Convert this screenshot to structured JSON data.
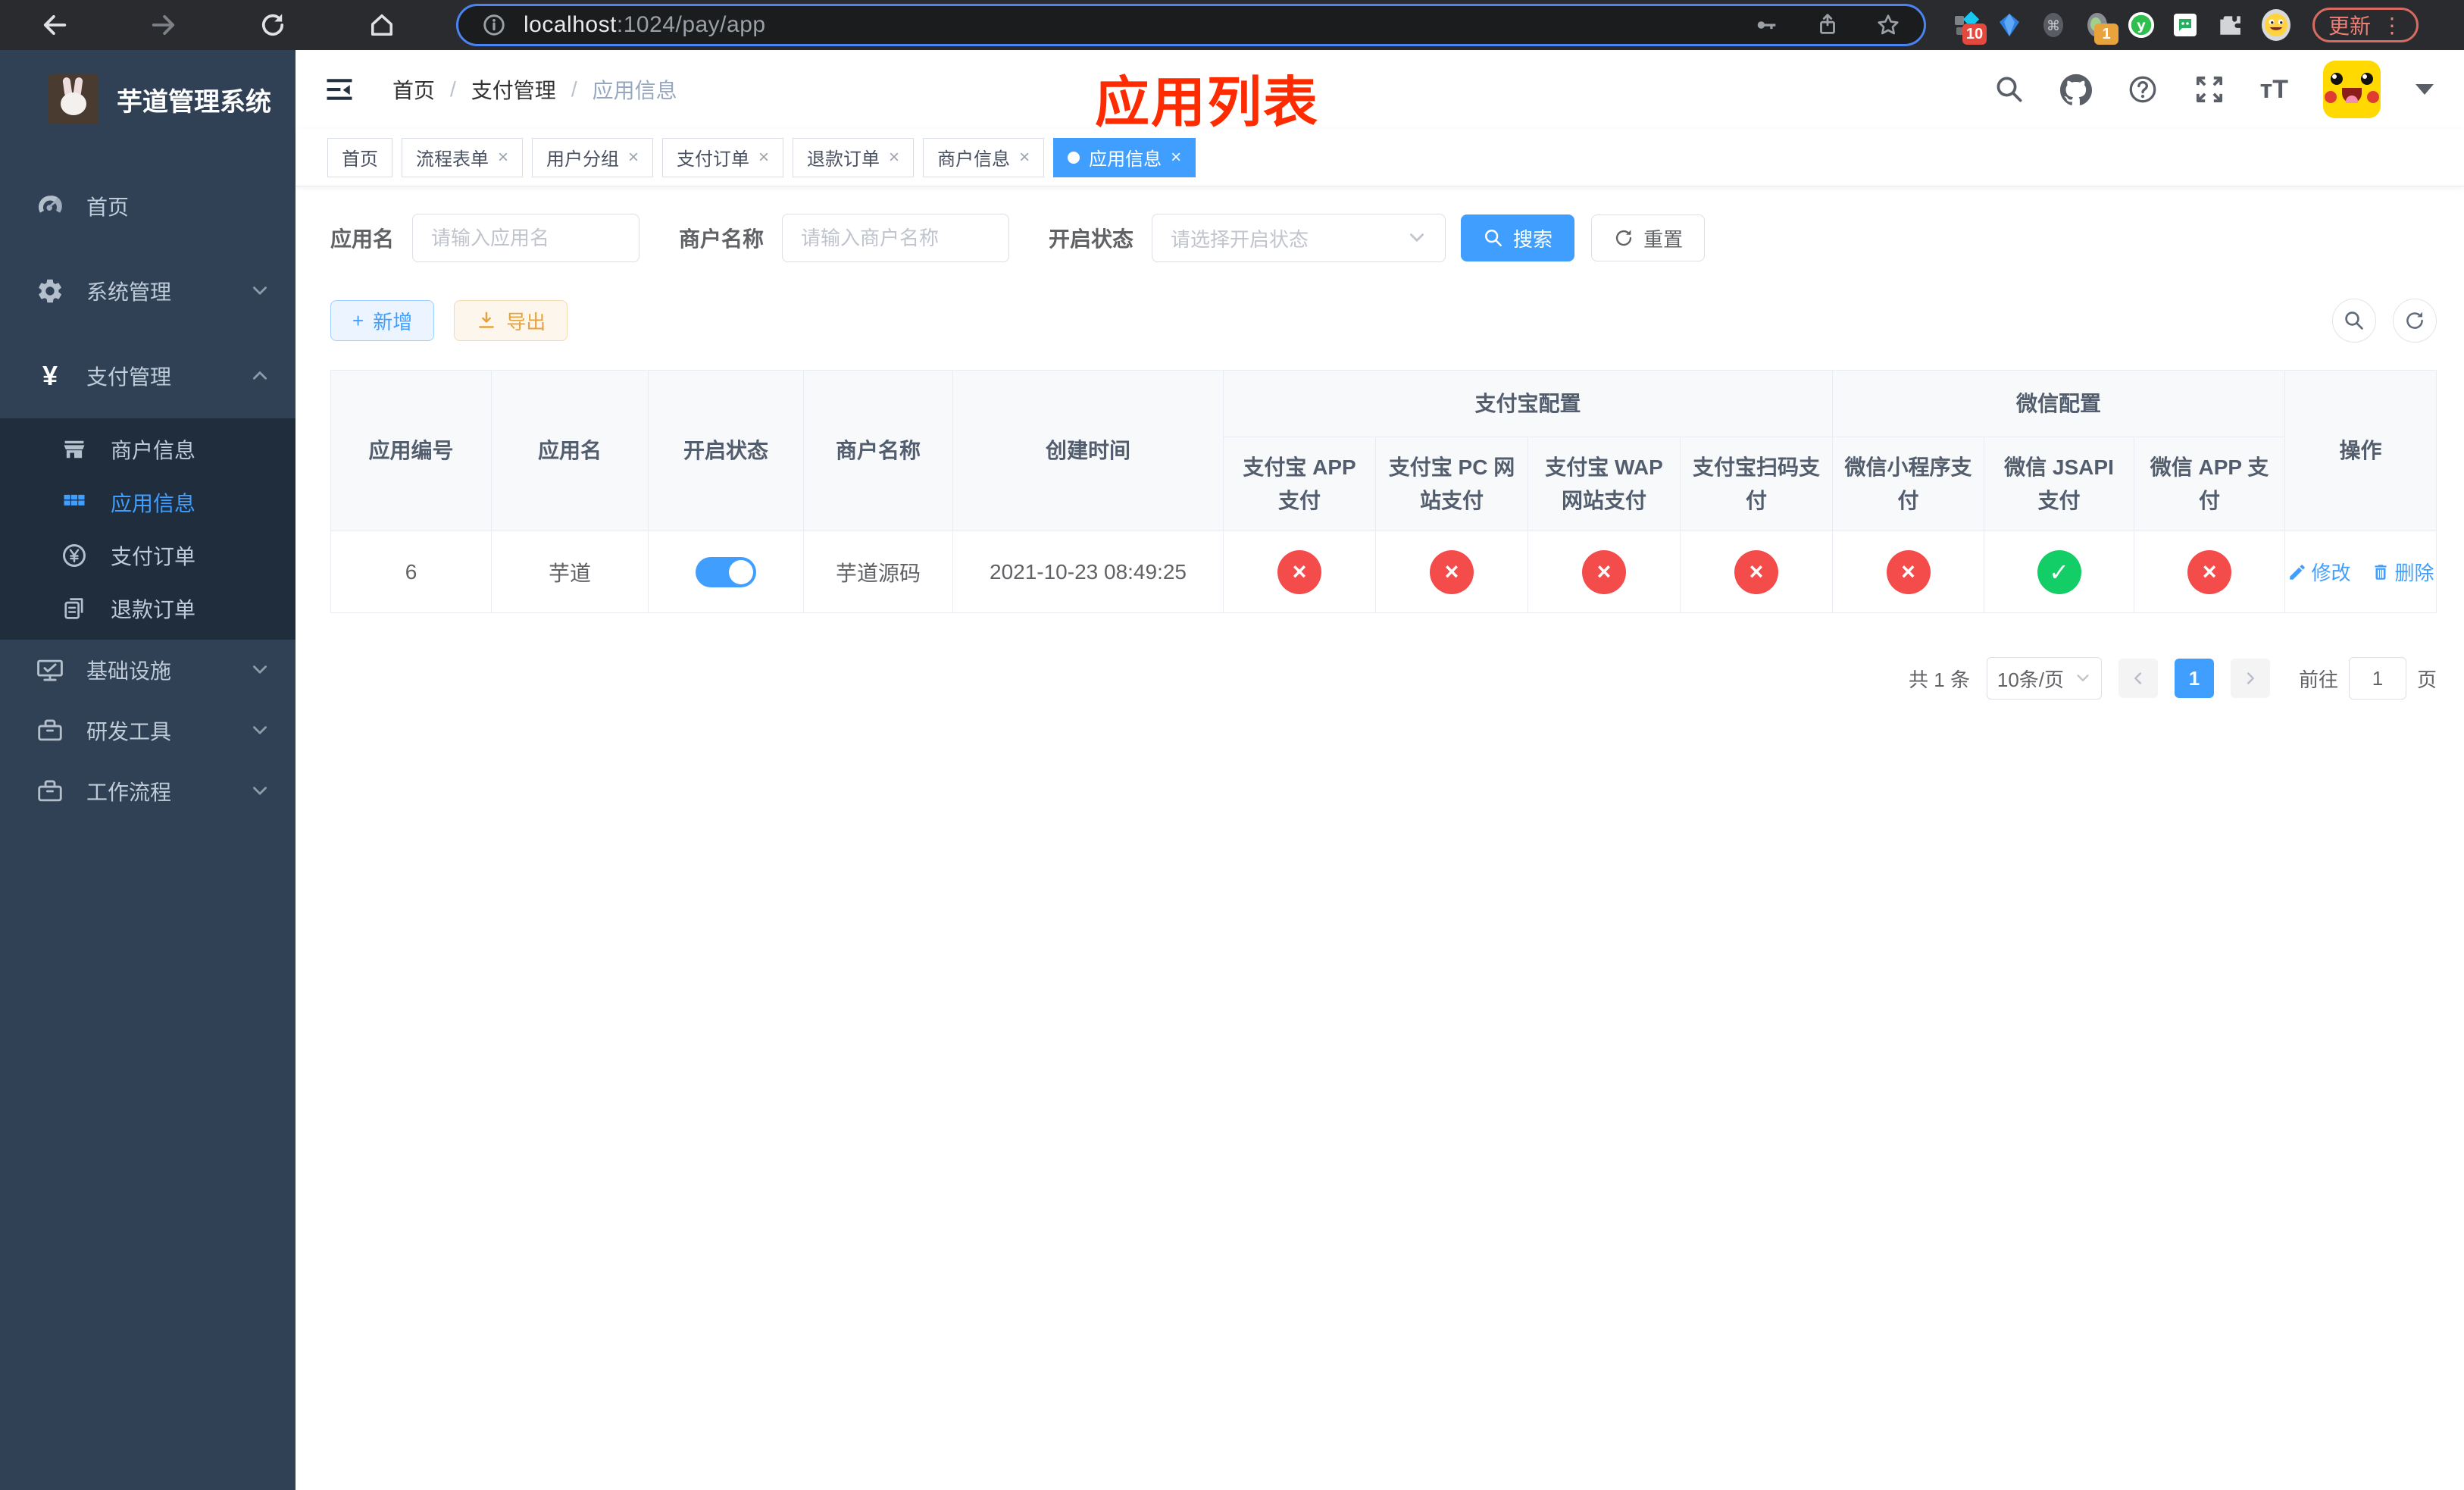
{
  "colors": {
    "primary": "#409eff",
    "success": "#13ce66",
    "danger": "#f44b4b",
    "warning": "#e6a23c",
    "sidebar_bg": "#304156",
    "submenu_bg": "#1f2d3d",
    "annotation_red": "#fe2b00",
    "focus_ring": "#4b84f0"
  },
  "icons": {
    "check": "✓",
    "cross": "×",
    "yuan": "¥",
    "plus": "+",
    "close": "×",
    "cmd": "⌘",
    "kebab": "⋮",
    "letter_y": "y",
    "text_size": "тT",
    "prev": "‹",
    "next": "›",
    "slash": "/"
  },
  "browser": {
    "url": {
      "host": "localhost",
      "path": ":1024/pay/app"
    },
    "update_button": "更新",
    "extensions": {
      "diamond_badge": "10",
      "dot_badge": "1"
    }
  },
  "sidebar": {
    "title": "芋道管理系统",
    "menu": [
      {
        "label": "首页"
      },
      {
        "label": "系统管理"
      },
      {
        "label": "支付管理"
      },
      {
        "label": "商户信息"
      },
      {
        "label": "应用信息"
      },
      {
        "label": "支付订单"
      },
      {
        "label": "退款订单"
      },
      {
        "label": "基础设施"
      },
      {
        "label": "研发工具"
      },
      {
        "label": "工作流程"
      }
    ]
  },
  "header": {
    "breadcrumb": {
      "item1": "首页",
      "item2": "支付管理",
      "item3": "应用信息"
    },
    "annotation": "应用列表"
  },
  "tabs": [
    {
      "label": "首页"
    },
    {
      "label": "流程表单"
    },
    {
      "label": "用户分组"
    },
    {
      "label": "支付订单"
    },
    {
      "label": "退款订单"
    },
    {
      "label": "商户信息"
    },
    {
      "label": "应用信息"
    }
  ],
  "filters": {
    "app_name_label": "应用名",
    "app_name_placeholder": "请输入应用名",
    "merchant_label": "商户名称",
    "merchant_placeholder": "请输入商户名称",
    "status_label": "开启状态",
    "status_placeholder": "请选择开启状态",
    "search_button": "搜索",
    "reset_button": "重置"
  },
  "toolbar": {
    "add_button": "新增",
    "export_button": "导出"
  },
  "table": {
    "headers": {
      "app_id": "应用编号",
      "app_name": "应用名",
      "status": "开启状态",
      "merchant": "商户名称",
      "created": "创建时间",
      "alipay_group": "支付宝配置",
      "wechat_group": "微信配置",
      "alipay_app": "支付宝 APP 支付",
      "alipay_pc": "支付宝 PC 网站支付",
      "alipay_wap": "支付宝 WAP 网站支付",
      "alipay_qr": "支付宝扫码支付",
      "wx_lite": "微信小程序支付",
      "wx_jsapi": "微信 JSAPI 支付",
      "wx_app": "微信 APP 支付",
      "actions": "操作"
    },
    "rows": [
      {
        "app_id": "6",
        "app_name": "芋道",
        "enabled": true,
        "merchant": "芋道源码",
        "created": "2021-10-23 08:49:25",
        "alipay_app": false,
        "alipay_pc": false,
        "alipay_wap": false,
        "alipay_qr": false,
        "wx_lite": false,
        "wx_jsapi": true,
        "wx_app": false,
        "edit_label": "修改",
        "delete_label": "删除"
      }
    ]
  },
  "pagination": {
    "total": "共 1 条",
    "page_size": "10条/页",
    "page": "1",
    "goto_label": "前往",
    "goto_value": "1",
    "page_suffix": "页"
  }
}
